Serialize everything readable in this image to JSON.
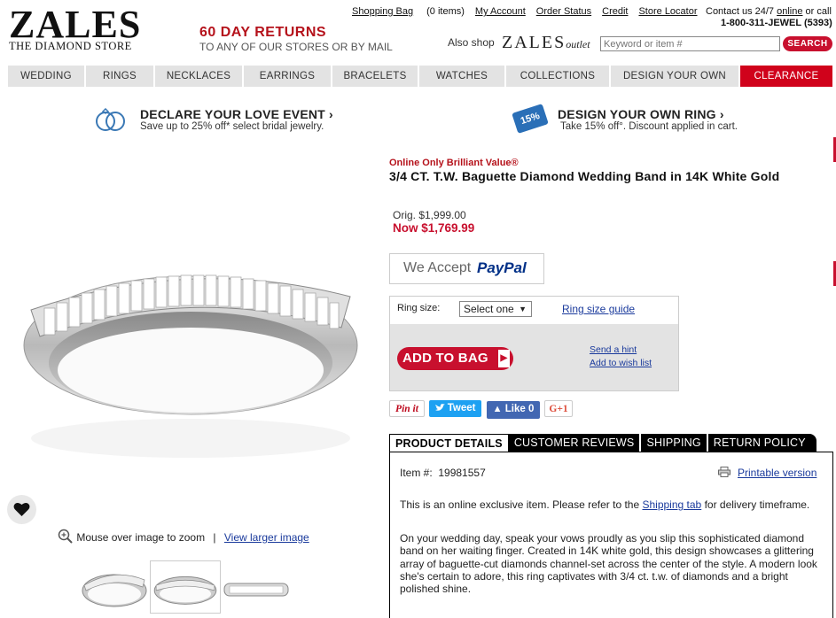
{
  "brand": {
    "logo": "ZALES",
    "tagline": "THE DIAMOND STORE",
    "returns_title": "60 DAY RETURNS",
    "returns_sub": "TO ANY OF OUR STORES OR BY MAIL"
  },
  "toplinks": {
    "bag": "Shopping Bag",
    "bag_count": "(0 items)",
    "account": "My Account",
    "order_status": "Order Status",
    "credit": "Credit",
    "store_locator": "Store Locator",
    "contact_prefix": "Contact us 24/7",
    "contact_online": "online",
    "contact_suffix": "or call",
    "phone": "1-800-311-JEWEL (5393)"
  },
  "search": {
    "also_shop": "Also shop",
    "outlet_logo": "ZALES",
    "outlet_word": "outlet",
    "placeholder": "Keyword or item #",
    "button": "SEARCH"
  },
  "nav": [
    "WEDDING",
    "RINGS",
    "NECKLACES",
    "EARRINGS",
    "BRACELETS",
    "WATCHES",
    "COLLECTIONS",
    "DESIGN YOUR OWN",
    "CLEARANCE"
  ],
  "promos": {
    "left_title": "DECLARE YOUR LOVE EVENT",
    "left_sub": "Save up to 25% off* select bridal jewelry.",
    "right_badge": "15%",
    "right_title": "DESIGN YOUR OWN RING",
    "right_sub": "Take 15% off°. Discount applied in cart."
  },
  "gallery": {
    "zoom_hint": "Mouse over image to zoom",
    "separator": "|",
    "larger": "View larger image"
  },
  "product": {
    "eyebrow": "Online Only Brilliant Value®",
    "title": "3/4 CT. T.W. Baguette Diamond Wedding Band in 14K White Gold",
    "orig_price": "Orig. $1,999.00",
    "now_price": "Now $1,769.99",
    "paypal_prefix": "We Accept",
    "paypal_brand": "PayPal",
    "ring_size_label": "Ring size:",
    "ring_size_value": "Select one",
    "ring_size_guide": "Ring size guide",
    "add_to_bag": "ADD TO BAG",
    "send_hint": "Send a hint",
    "wish_list": "Add to wish list"
  },
  "social": {
    "pinterest": "Pin it",
    "tweet": "Tweet",
    "like": "Like 0",
    "gplus": "G+1"
  },
  "tabs": [
    "PRODUCT DETAILS",
    "CUSTOMER REVIEWS",
    "SHIPPING",
    "RETURN POLICY"
  ],
  "details": {
    "item_label": "Item #:",
    "item_number": "19981557",
    "printable": "Printable version",
    "exclusive_prefix": "This is an online exclusive item. Please refer to the",
    "exclusive_link": "Shipping tab",
    "exclusive_suffix": "for delivery timeframe.",
    "description": "On your wedding day, speak your vows proudly as you slip this sophisticated diamond band on her waiting finger. Created in 14K white gold, this design showcases a glittering array of baguette-cut diamonds channel-set across the center of the style. A modern look she's certain to adore, this ring captivates with 3/4 ct. t.w. of diamonds and a bright polished shine."
  },
  "colors": {
    "brand_red": "#c8102e",
    "nav_gray": "#e3e3e3",
    "link_blue": "#1a3a9c",
    "badge_blue": "#2a6fb7"
  }
}
